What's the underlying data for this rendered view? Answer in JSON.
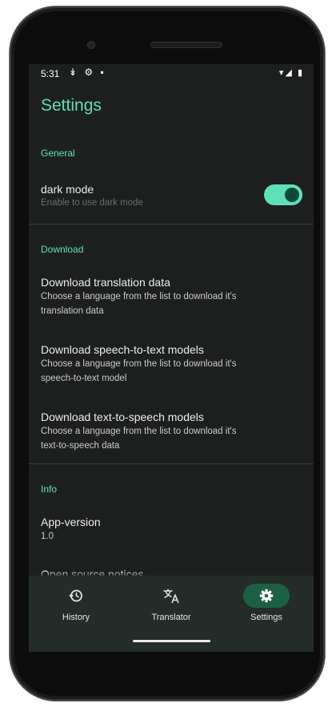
{
  "status_bar": {
    "time": "5:31",
    "left_icons": "↡ ⚙ ▪",
    "right_icons": "▾◢ ▮"
  },
  "header": {
    "title": "Settings"
  },
  "sections": {
    "general": {
      "label": "General",
      "dark_mode": {
        "title": "dark mode",
        "subtitle": "Enable to use dark mode",
        "enabled": true
      }
    },
    "download": {
      "label": "Download",
      "items": [
        {
          "title": "Download translation data",
          "subtitle_line1": "Choose a language from the list to download it's",
          "subtitle_line2": "translation data"
        },
        {
          "title": "Download speech-to-text models",
          "subtitle_line1": "Choose a language from the list to download it's",
          "subtitle_line2": "speech-to-text model"
        },
        {
          "title": "Download text-to-speech models",
          "subtitle_line1": "Choose a language from the list to download it's",
          "subtitle_line2": "text-to-speech data"
        }
      ]
    },
    "info": {
      "label": "Info",
      "app_version": {
        "title": "App-version",
        "value": "1.0"
      },
      "open_source": {
        "title": "Open source notices"
      }
    }
  },
  "bottom_nav": {
    "items": [
      {
        "label": "History",
        "icon": "history-icon"
      },
      {
        "label": "Translator",
        "icon": "translate-icon"
      },
      {
        "label": "Settings",
        "icon": "gear-icon",
        "active": true
      }
    ]
  },
  "colors": {
    "accent": "#5fe0b8",
    "background": "#1d1f1e",
    "nav_background": "#232c28",
    "active_pill": "#1b5f44"
  }
}
